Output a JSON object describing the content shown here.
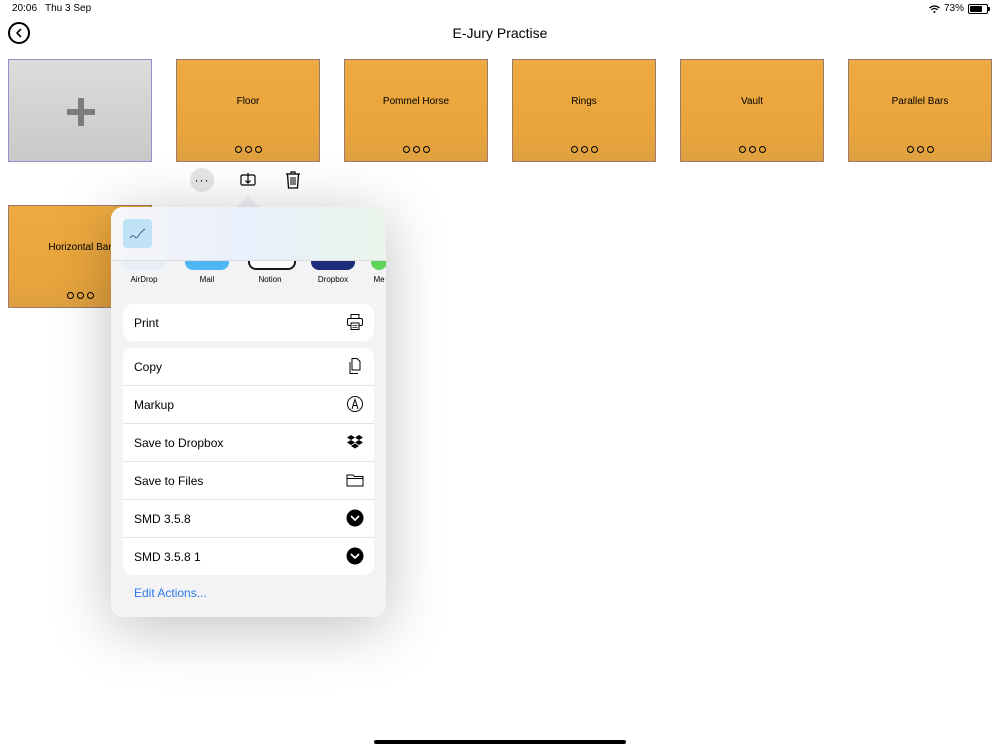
{
  "status_bar": {
    "time": "20:06",
    "date": "Thu 3 Sep",
    "battery": "73%",
    "battery_level": 0.73
  },
  "header": {
    "title": "E-Jury Practise"
  },
  "tiles": [
    {
      "label": "Floor"
    },
    {
      "label": "Pommel Horse"
    },
    {
      "label": "Rings"
    },
    {
      "label": "Vault"
    },
    {
      "label": "Parallel Bars"
    },
    {
      "label": "Horizontal Bar"
    }
  ],
  "tile_actions": {
    "more": "···"
  },
  "share_sheet": {
    "apps": [
      {
        "name": "AirDrop",
        "color": "#e8eef6"
      },
      {
        "name": "Mail",
        "color": "#4fb6f4"
      },
      {
        "name": "Notion",
        "color": "#1a1a1a"
      },
      {
        "name": "Dropbox",
        "color": "#1d2b7a"
      },
      {
        "name": "Me",
        "color": "#5fd35a"
      }
    ],
    "print_label": "Print",
    "actions": [
      {
        "label": "Copy",
        "icon": "copy-icon"
      },
      {
        "label": "Markup",
        "icon": "markup-icon"
      },
      {
        "label": "Save to Dropbox",
        "icon": "dropbox-icon"
      },
      {
        "label": "Save to Files",
        "icon": "folder-icon"
      },
      {
        "label": "SMD 3.5.8",
        "icon": "shortcut-icon"
      },
      {
        "label": "SMD 3.5.8 1",
        "icon": "shortcut-icon"
      }
    ],
    "edit_actions": "Edit Actions..."
  },
  "colors": {
    "tile": "#eaa63c",
    "accent": "#2a7be4",
    "tile_border": "#9c7a70"
  }
}
